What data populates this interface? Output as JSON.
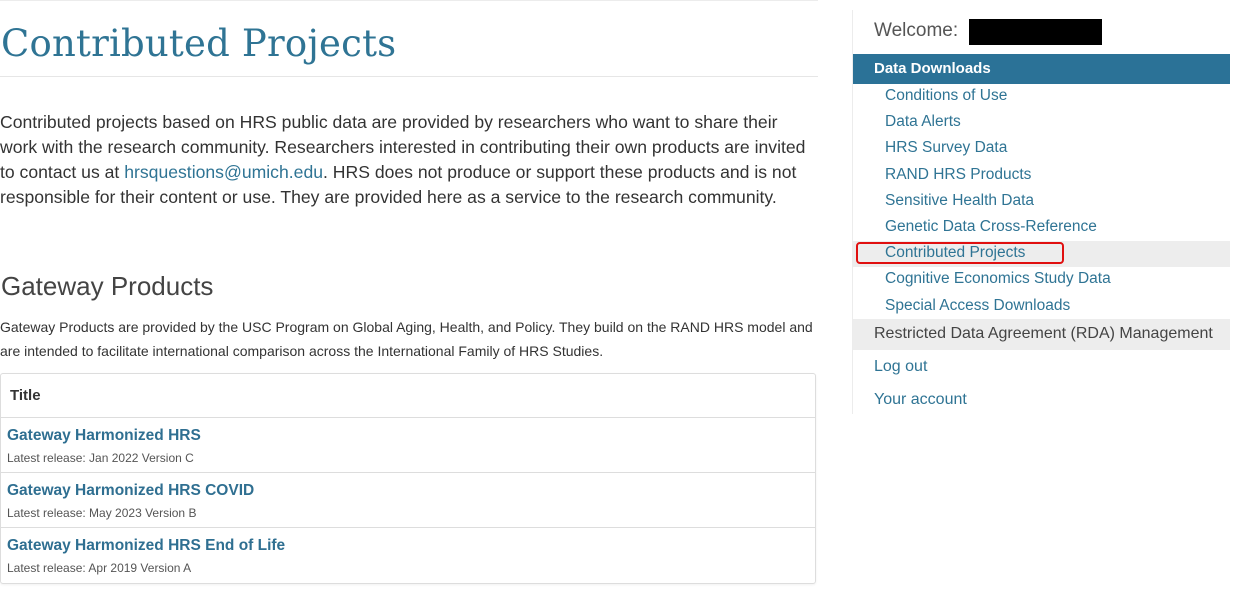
{
  "main": {
    "title": "Contributed Projects",
    "intro": {
      "text_before": "Contributed projects based on HRS public data are provided by researchers who want to share their work with the research community. Researchers interested in contributing their own products are invited to contact us at ",
      "email": "hrsquestions@umich.edu",
      "text_after": ". HRS does not produce or support these products and is not responsible for their content or use. They are provided here as a service to the research community."
    },
    "section": {
      "heading": "Gateway Products",
      "description": "Gateway Products are provided by the USC Program on Global Aging, Health, and Policy. They build on the RAND HRS model and are intended to facilitate international comparison across the International Family of HRS Studies."
    },
    "table": {
      "header": "Title",
      "rows": [
        {
          "title": "Gateway Harmonized HRS",
          "release": "Latest release: Jan 2022 Version C"
        },
        {
          "title": "Gateway Harmonized HRS COVID",
          "release": "Latest release: May 2023 Version B"
        },
        {
          "title": "Gateway Harmonized HRS End of Life",
          "release": "Latest release: Apr 2019 Version A"
        }
      ]
    }
  },
  "sidebar": {
    "welcome": "Welcome:",
    "nav_header": "Data Downloads",
    "items": [
      {
        "label": "Conditions of Use"
      },
      {
        "label": "Data Alerts"
      },
      {
        "label": "HRS Survey Data"
      },
      {
        "label": "RAND HRS Products"
      },
      {
        "label": "Sensitive Health Data"
      },
      {
        "label": "Genetic Data Cross-Reference"
      },
      {
        "label": "Contributed Projects"
      },
      {
        "label": "Cognitive Economics Study Data"
      },
      {
        "label": "Special Access Downloads"
      }
    ],
    "rda": "Restricted Data Agreement (RDA) Management",
    "logout": "Log out",
    "account": "Your account"
  },
  "colors": {
    "accent": "#2b7297",
    "link": "#2f7494",
    "highlight_outline": "#e01010"
  }
}
